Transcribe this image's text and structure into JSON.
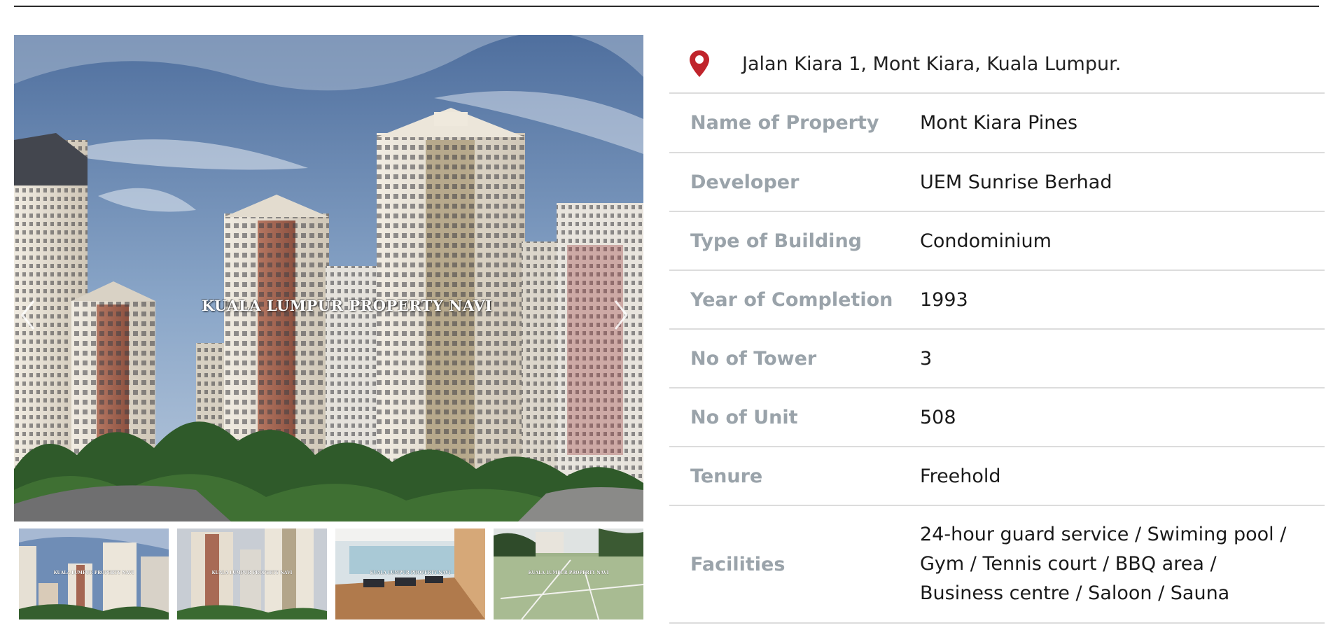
{
  "gallery": {
    "watermark": "KUALA LUMPUR PROPERTY NAVI",
    "prev_icon": "chevron-left-icon",
    "next_icon": "chevron-right-icon",
    "thumbnails": [
      {
        "watermark": "KUALA LUMPUR PROPERTY NAVI",
        "scene": "towers-sky"
      },
      {
        "watermark": "KUALA LUMPUR PROPERTY NAVI",
        "scene": "towers-close"
      },
      {
        "watermark": "KUALA LUMPUR PROPERTY NAVI",
        "scene": "gym"
      },
      {
        "watermark": "KUALA LUMPUR PROPERTY NAVI",
        "scene": "tennis-court"
      }
    ]
  },
  "details": {
    "location_icon": "map-pin-icon",
    "address": "Jalan Kiara 1, Mont Kiara, Kuala Lumpur.",
    "rows": [
      {
        "label": "Name of Property",
        "value": "Mont Kiara Pines"
      },
      {
        "label": "Developer",
        "value": "UEM Sunrise Berhad"
      },
      {
        "label": "Type of Building",
        "value": "Condominium"
      },
      {
        "label": "Year of Completion",
        "value": "1993"
      },
      {
        "label": "No of Tower",
        "value": "3"
      },
      {
        "label": "No of Unit",
        "value": "508"
      },
      {
        "label": "Tenure",
        "value": "Freehold"
      }
    ],
    "facilities": {
      "label": "Facilities",
      "lines": [
        "24-hour guard service / Swiming pool /",
        "Gym / Tennis court / BBQ area /",
        "Business centre / Saloon / Sauna"
      ]
    }
  },
  "colors": {
    "pin": "#c0242b",
    "label": "#9aa3aa",
    "divider": "#dcdcdc"
  }
}
